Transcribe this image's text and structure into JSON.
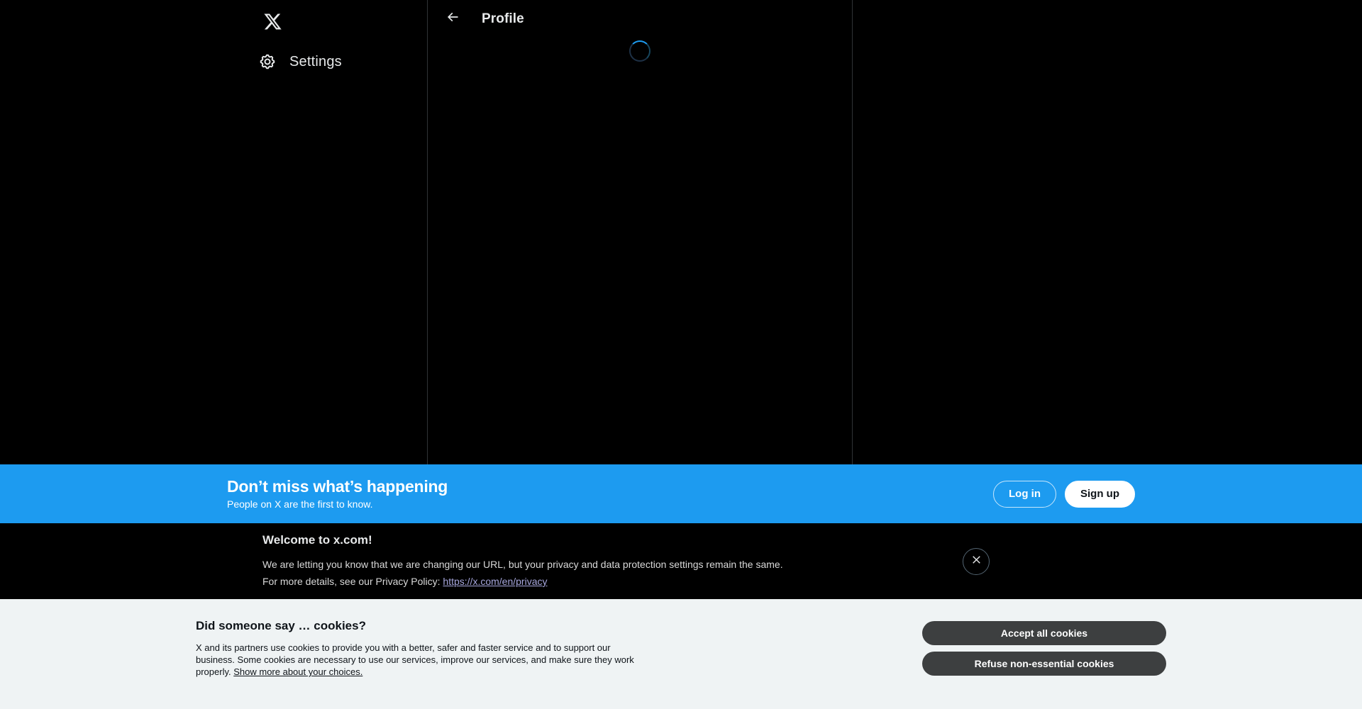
{
  "sidebar": {
    "logo_icon": "x-logo-icon",
    "items": [
      {
        "icon": "gear-icon",
        "label": "Settings"
      }
    ]
  },
  "main": {
    "back_icon": "arrow-left-icon",
    "title": "Profile",
    "loading_indicator": "loading-spinner"
  },
  "signup_banner": {
    "title": "Don’t miss what’s happening",
    "subtitle": "People on X are the first to know.",
    "login_label": "Log in",
    "signup_label": "Sign up",
    "background_color": "#1d9bf0"
  },
  "welcome_notice": {
    "title": "Welcome to x.com!",
    "line1": "We are letting you know that we are changing our URL, but your privacy and data protection settings remain the same.",
    "line2_prefix": "For more details, see our Privacy Policy: ",
    "link_text": "https://x.com/en/privacy",
    "link_color": "#a7a7dd",
    "close_icon": "close-icon"
  },
  "cookie_banner": {
    "title": "Did someone say … cookies?",
    "body": "X and its partners use cookies to provide you with a better, safer and faster service and to support our business. Some cookies are necessary to use our services, improve our services, and make sure they work properly. ",
    "link_text": "Show more about your choices.",
    "accept_label": "Accept all cookies",
    "refuse_label": "Refuse non-essential cookies",
    "background_color": "#eff3f4",
    "button_color": "#3d3f40"
  }
}
